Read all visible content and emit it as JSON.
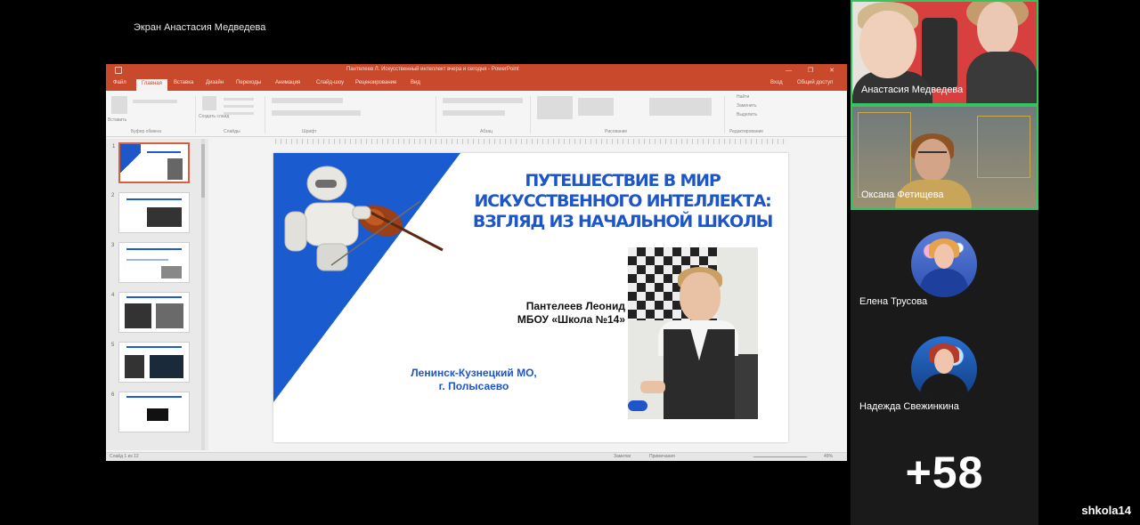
{
  "share": {
    "label": "Экран Анастасия Медведева"
  },
  "ppt": {
    "window_title": "Пантелеев Л. Искусственный интеллект вчера и сегодня - PowerPoint",
    "tabs": [
      "Файл",
      "Главная",
      "Вставка",
      "Дизайн",
      "Переходы",
      "Анимация",
      "Слайд-шоу",
      "Рецензирование",
      "Вид"
    ],
    "active_tab": "Главная",
    "right_tabs": [
      "Вход",
      "Общий доступ"
    ],
    "ribbon_groups": [
      "Буфер обмена",
      "Слайды",
      "Шрифт",
      "Абзац",
      "Рисование",
      "Редактирование"
    ],
    "ribbon_buttons": {
      "paste": "Вставить",
      "new_slide": "Создать слайд",
      "find": "Найти",
      "replace": "Заменить",
      "select": "Выделить"
    },
    "thumb_numbers": [
      "1",
      "2",
      "3",
      "4",
      "5",
      "6"
    ],
    "status": {
      "slide": "Слайд 1 из 12",
      "notes": "Заметки",
      "comments": "Примечания",
      "zoom": "49%"
    }
  },
  "slide": {
    "title_lines": [
      "Путешествие в мир",
      "искусственного интеллекта:",
      "взгляд из начальной школы"
    ],
    "author_name": "Пантелеев Леонид",
    "author_school": "МБОУ «Школа №14»",
    "location_1": "Ленинск-Кузнецкий МО,",
    "location_2": "г. Полысаево"
  },
  "participants": [
    {
      "name": "Анастасия Медведева",
      "video": true,
      "speaking": true
    },
    {
      "name": "Оксана Фетищева",
      "video": true,
      "speaking": true
    },
    {
      "name": "Елена Трусова",
      "video": false
    },
    {
      "name": "Надежда Свежинкина",
      "video": false
    }
  ],
  "more_count": "+58",
  "watermark": "shkola14",
  "colors": {
    "accent_blue": "#1d56c9",
    "ppt_orange": "#c8492c",
    "active_border": "#33c55e"
  }
}
